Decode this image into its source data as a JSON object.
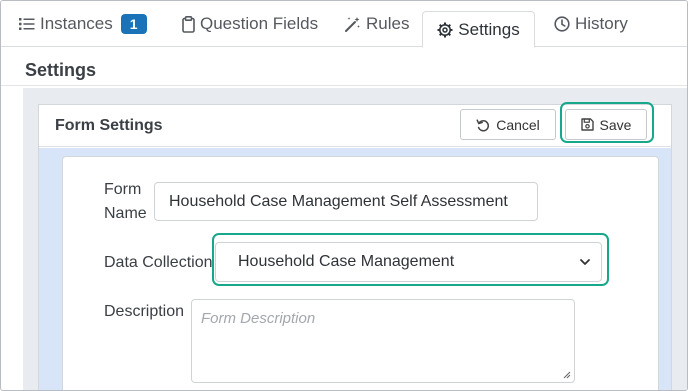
{
  "tabs": [
    {
      "label": "Instances",
      "badge": "1",
      "icon": "list-icon"
    },
    {
      "label": "Question Fields",
      "icon": "clipboard-icon"
    },
    {
      "label": "Rules",
      "icon": "magic-wand-icon"
    },
    {
      "label": "Settings",
      "icon": "gear-icon",
      "active": true
    },
    {
      "label": "History",
      "icon": "clock-icon"
    }
  ],
  "page": {
    "title": "Settings"
  },
  "form_settings": {
    "title": "Form Settings",
    "cancel_label": "Cancel",
    "save_label": "Save",
    "form_name_label_line1": "Form",
    "form_name_label_line2": "Name",
    "form_name_value": "Household Case Management Self Assessment",
    "data_collection_label": "Data Collection",
    "data_collection_value": "Household Case Management",
    "description_label": "Description",
    "description_placeholder": "Form Description"
  },
  "colors": {
    "accent_badge": "#1a73b8",
    "highlight": "#17a88c",
    "panel_bg": "#d8e4f7"
  }
}
